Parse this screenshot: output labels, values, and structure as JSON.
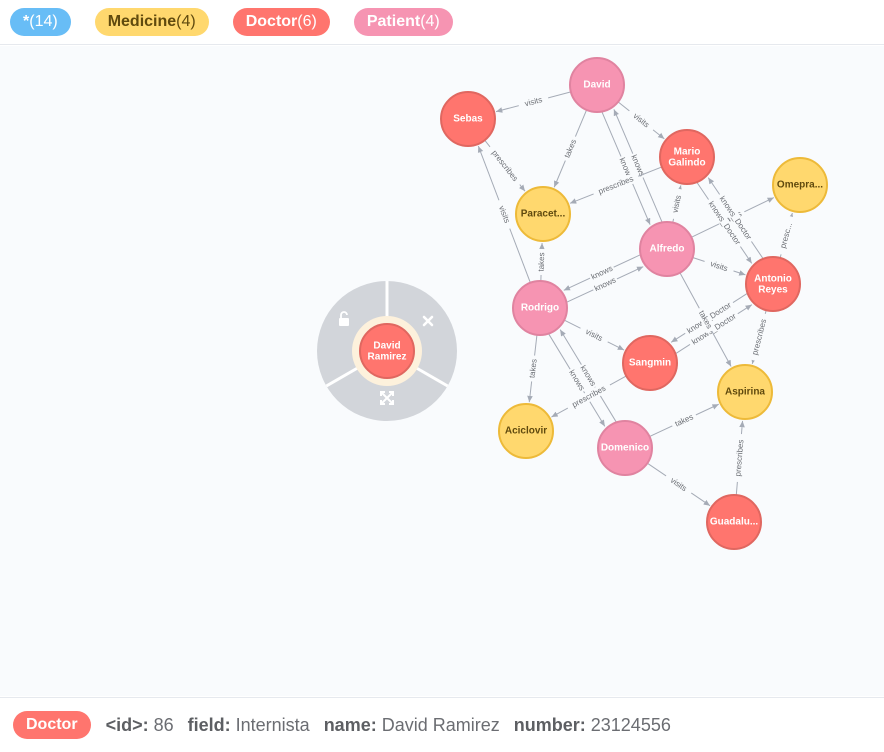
{
  "legend": {
    "all": {
      "label": "*",
      "count": "(14)",
      "color": "#68bdf6"
    },
    "medicine": {
      "label": "Medicine",
      "count": "(4)",
      "color": "#ffd86e"
    },
    "doctor": {
      "label": "Doctor",
      "count": "(6)",
      "color": "#ff756e"
    },
    "patient": {
      "label": "Patient",
      "count": "(4)",
      "color": "#f694b2"
    }
  },
  "graph": {
    "nodes": [
      {
        "id": "david",
        "label": "David",
        "type": "patient"
      },
      {
        "id": "sebas",
        "label": "Sebas",
        "type": "doctor"
      },
      {
        "id": "mario",
        "label": "Mario",
        "label2": "Galindo",
        "type": "doctor"
      },
      {
        "id": "omepra",
        "label": "Omepra...",
        "type": "medicine"
      },
      {
        "id": "paracet",
        "label": "Paracet...",
        "type": "medicine"
      },
      {
        "id": "alfredo",
        "label": "Alfredo",
        "type": "patient"
      },
      {
        "id": "antonio",
        "label": "Antonio",
        "label2": "Reyes",
        "type": "doctor"
      },
      {
        "id": "rodrigo",
        "label": "Rodrigo",
        "type": "patient"
      },
      {
        "id": "sangmin",
        "label": "Sangmin",
        "type": "doctor"
      },
      {
        "id": "aspirina",
        "label": "Aspirina",
        "type": "medicine"
      },
      {
        "id": "aciclovir",
        "label": "Aciclovir",
        "type": "medicine"
      },
      {
        "id": "domenico",
        "label": "Domenico",
        "type": "patient"
      },
      {
        "id": "guadalu",
        "label": "Guadalu...",
        "type": "doctor"
      },
      {
        "id": "davidramirez",
        "label": "David",
        "label2": "Ramirez",
        "type": "doctor",
        "selected": true
      }
    ],
    "relationships": [
      {
        "from": "david",
        "to": "sebas",
        "label": "visits"
      },
      {
        "from": "david",
        "to": "mario",
        "label": "visits"
      },
      {
        "from": "david",
        "to": "paracet",
        "label": "takes"
      },
      {
        "from": "david",
        "to": "alfredo",
        "label": "knows"
      },
      {
        "from": "alfredo",
        "to": "david",
        "label": "knows"
      },
      {
        "from": "mario",
        "to": "paracet",
        "label": "prescribes"
      },
      {
        "from": "sebas",
        "to": "paracet",
        "label": "prescribes"
      },
      {
        "from": "rodrigo",
        "to": "sebas",
        "label": "visits"
      },
      {
        "from": "alfredo",
        "to": "mario",
        "label": "visits"
      },
      {
        "from": "alfredo",
        "to": "omepra",
        "label": "takes"
      },
      {
        "from": "mario",
        "to": "antonio",
        "label": "knows_Doctor"
      },
      {
        "from": "antonio",
        "to": "mario",
        "label": "knows_Doctor"
      },
      {
        "from": "antonio",
        "to": "omepra",
        "label": "presc..."
      },
      {
        "from": "alfredo",
        "to": "antonio",
        "label": "visits"
      },
      {
        "from": "rodrigo",
        "to": "alfredo",
        "label": "knows"
      },
      {
        "from": "alfredo",
        "to": "rodrigo",
        "label": "knows"
      },
      {
        "from": "rodrigo",
        "to": "paracet",
        "label": "takes"
      },
      {
        "from": "rodrigo",
        "to": "sangmin",
        "label": "visits"
      },
      {
        "from": "sangmin",
        "to": "antonio",
        "label": "knows_Doctor"
      },
      {
        "from": "antonio",
        "to": "sangmin",
        "label": "knows_Doctor"
      },
      {
        "from": "alfredo",
        "to": "aspirina",
        "label": "takes"
      },
      {
        "from": "antonio",
        "to": "aspirina",
        "label": "prescribes"
      },
      {
        "from": "rodrigo",
        "to": "aciclovir",
        "label": "takes"
      },
      {
        "from": "rodrigo",
        "to": "domenico",
        "label": "knows"
      },
      {
        "from": "domenico",
        "to": "rodrigo",
        "label": "knows"
      },
      {
        "from": "sangmin",
        "to": "aciclovir",
        "label": "prescribes"
      },
      {
        "from": "domenico",
        "to": "aspirina",
        "label": "takes"
      },
      {
        "from": "domenico",
        "to": "guadalu",
        "label": "visits"
      },
      {
        "from": "guadalu",
        "to": "aspirina",
        "label": "prescribes"
      }
    ],
    "colors": {
      "doctor": {
        "fill": "#ff756e",
        "stroke": "#e06760",
        "text": "#ffffff"
      },
      "patient": {
        "fill": "#f694b2",
        "stroke": "#e083a0",
        "text": "#ffffff"
      },
      "medicine": {
        "fill": "#ffd86e",
        "stroke": "#edba39",
        "text": "#604a0e"
      },
      "ring_menu": "#d2d5da",
      "selection_halo": "#fdf1dc"
    },
    "ring_menu_icons": [
      "unlock-icon",
      "close-icon",
      "expand-icon"
    ]
  },
  "details": {
    "label": "Doctor",
    "properties": [
      {
        "key": "<id>:",
        "value": "86"
      },
      {
        "key": "field:",
        "value": "Internista"
      },
      {
        "key": "name:",
        "value": "David Ramirez"
      },
      {
        "key": "number:",
        "value": "23124556"
      }
    ]
  }
}
